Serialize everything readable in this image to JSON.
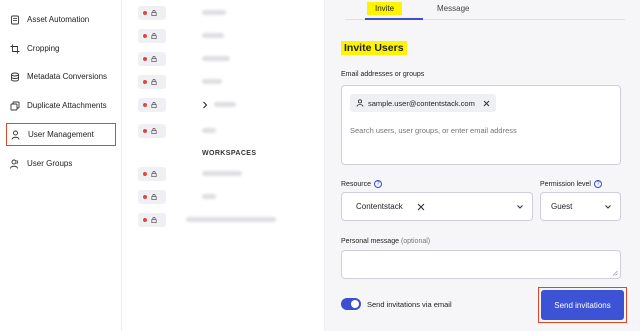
{
  "sidebar": {
    "items": [
      {
        "label": "Asset Automation",
        "icon": "asset-automation-icon"
      },
      {
        "label": "Cropping",
        "icon": "crop-icon"
      },
      {
        "label": "Metadata Conversions",
        "icon": "metadata-icon"
      },
      {
        "label": "Duplicate Attachments",
        "icon": "duplicate-icon"
      },
      {
        "label": "User Management",
        "icon": "user-management-icon",
        "active": true
      },
      {
        "label": "User Groups",
        "icon": "user-groups-icon"
      }
    ]
  },
  "middle": {
    "workspaces_label": "WORKSPACES"
  },
  "panel": {
    "tabs": [
      {
        "label": "Invite",
        "active": true
      },
      {
        "label": "Message",
        "active": false
      }
    ],
    "title": "Invite Users",
    "email_label": "Email addresses or groups",
    "email_chip": "sample.user@contentstack.com",
    "email_placeholder": "Search users, user groups, or enter email address",
    "resource_label": "Resource",
    "resource_value": "Contentstack",
    "permission_label": "Permission level",
    "permission_value": "Guest",
    "message_label": "Personal message",
    "message_optional": "(optional)",
    "toggle_label": "Send invitations via email",
    "send_button": "Send invitations"
  },
  "colors": {
    "accent": "#3d53d6",
    "highlight": "#fff400",
    "annotation": "#e2462a"
  }
}
